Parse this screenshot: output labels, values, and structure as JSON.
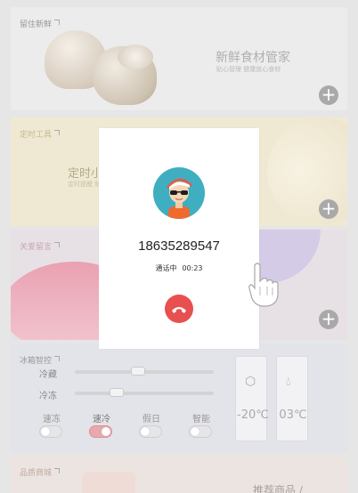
{
  "cards": {
    "fresh": {
      "title": "留住新鲜",
      "heading": "新鲜食材管家",
      "subtitle": "贴心管理  健康放心食材",
      "add_label": "+"
    },
    "timer": {
      "title": "定时工具",
      "heading": "定时小",
      "subtitle": "定时提醒 贴心关怀",
      "add_label": "+"
    },
    "message": {
      "title": "关爱留言",
      "add_label": "+"
    },
    "fridge": {
      "title": "冰箱智控",
      "rows": [
        {
          "label": "冷藏",
          "level": 0.45
        },
        {
          "label": "冷冻",
          "level": 0.28
        }
      ],
      "modes": [
        {
          "label": "速冻",
          "on": false
        },
        {
          "label": "速冷",
          "on": true
        },
        {
          "label": "假日",
          "on": false
        },
        {
          "label": "智能",
          "on": false
        }
      ],
      "temps": [
        {
          "icon": "hexagon-icon",
          "value": "-20℃"
        },
        {
          "icon": "droplet-icon",
          "value": "03℃"
        }
      ]
    },
    "shop": {
      "title": "品质商城",
      "heading": "推荐商品 /"
    }
  },
  "call": {
    "number": "18635289547",
    "status_label": "通话中",
    "duration": "00:23",
    "hangup_color": "#e8504f",
    "avatar_bg": "#3eaec0"
  }
}
